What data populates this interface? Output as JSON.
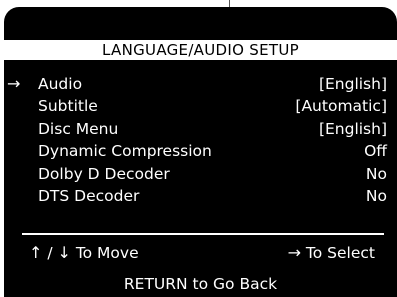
{
  "screen": {
    "title": "LANGUAGE/AUDIO SETUP"
  },
  "menu": {
    "cursor": "→",
    "items": [
      {
        "label": "Audio",
        "value": "[English]",
        "selected": true
      },
      {
        "label": "Subtitle",
        "value": "[Automatic]",
        "selected": false
      },
      {
        "label": "Disc Menu",
        "value": "[English]",
        "selected": false
      },
      {
        "label": "Dynamic Compression",
        "value": "Off",
        "selected": false
      },
      {
        "label": "Dolby D Decoder",
        "value": "No",
        "selected": false
      },
      {
        "label": "DTS Decoder",
        "value": "No",
        "selected": false
      }
    ]
  },
  "hints": {
    "up_arrow": "↑",
    "separator": " / ",
    "down_arrow": "↓",
    "move_text": " To Move",
    "select_arrow": "→",
    "select_text": " To Select",
    "return_text": "RETURN to Go Back"
  },
  "colors": {
    "background": "#000000",
    "text": "#ffffff",
    "title_bar": "#ffffff",
    "title_text": "#000000"
  },
  "icons": {
    "cursor": "right-arrow-icon",
    "move_up": "up-arrow-icon",
    "move_down": "down-arrow-icon",
    "select": "right-arrow-icon"
  }
}
